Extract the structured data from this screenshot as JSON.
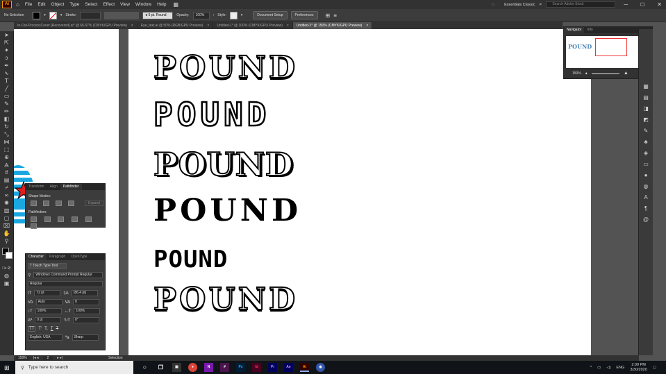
{
  "app": {
    "logo": "Ai",
    "menus": [
      "File",
      "Edit",
      "Object",
      "Type",
      "Select",
      "Effect",
      "View",
      "Window",
      "Help"
    ],
    "workspace": "Essentials Classic",
    "search_placeholder": "Search Adobe Stock"
  },
  "control_bar": {
    "selection_label": "No Selection",
    "stroke_label": "Stroke:",
    "brush": "5 pt. Round",
    "opacity_label": "Opacity:",
    "opacity_value": "100%",
    "style_label": "Style:",
    "document_setup": "Document Setup",
    "preferences": "Preferences"
  },
  "tabs": [
    {
      "label": "In-Out-ProcessCover [Recovered].ai* @ 66.67% (CMYK/GPU Preview)",
      "active": false
    },
    {
      "label": "Eye_text.ai @ 50% (RGB/GPU Preview)",
      "active": false
    },
    {
      "label": "Untitled-1* @ 100% (CMYK/GPU Preview)",
      "active": false
    },
    {
      "label": "Untitled-2* @ 150% (CMYK/GPU Preview)",
      "active": true
    }
  ],
  "artboard": {
    "words": [
      "POUND",
      "POUND",
      "POUND",
      "POUND",
      "POUND",
      "POUND"
    ]
  },
  "navigator": {
    "tabs": [
      "Navigator",
      "Info"
    ],
    "zoom": "150%",
    "thumb_text": "POUND"
  },
  "pathfinder": {
    "tabs": [
      "Transform",
      "Align",
      "Pathfinder"
    ],
    "shape_modes": "Shape Modes:",
    "expand": "Expand",
    "pathfinders": "Pathfinders:"
  },
  "character": {
    "tabs": [
      "Character",
      "Paragraph",
      "OpenType"
    ],
    "touch_type": "Touch Type Tool",
    "font": "Windows Command Prompt Regular",
    "style": "Regular",
    "size": "72 pt",
    "leading": "(86.4 pt)",
    "kerning": "Auto",
    "tracking": "0",
    "v_scale": "100%",
    "h_scale": "100%",
    "baseline": "0 pt",
    "rotation": "0°",
    "language": "English: USA",
    "antialias": "Sharp",
    "tt_label": "TT",
    "sup_label": "T'",
    "sub_label": "T,"
  },
  "status": {
    "zoom": "150%",
    "page": "2",
    "tool": "Selection"
  },
  "taskbar": {
    "search": "Type here to search",
    "apps": [
      "Ps",
      "Id",
      "Pr",
      "Ae",
      "Ai"
    ],
    "lang": "ENG",
    "time": "2:09 PM",
    "date": "3/30/2020"
  }
}
